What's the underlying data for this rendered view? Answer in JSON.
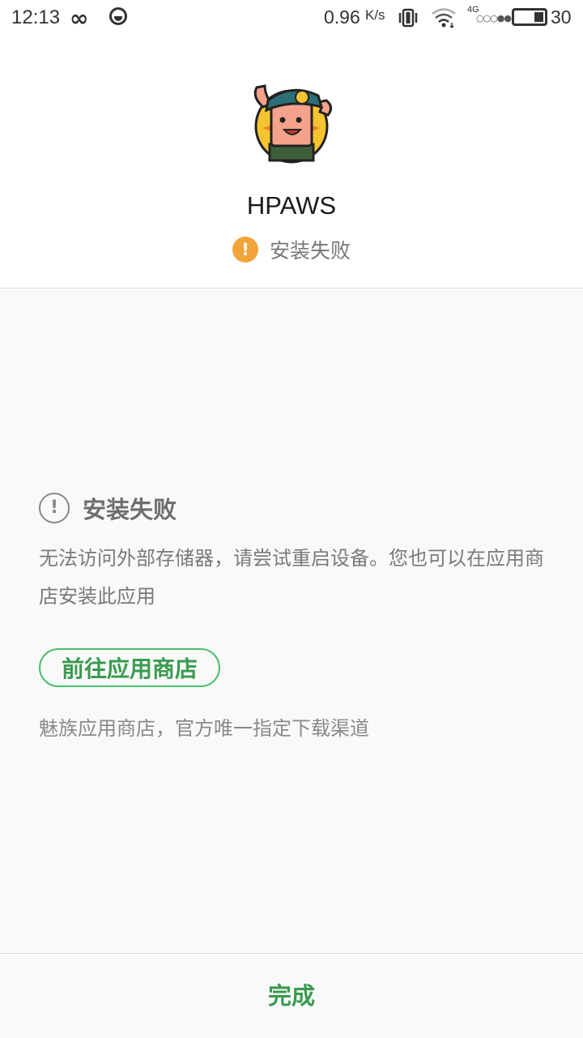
{
  "status_bar": {
    "time": "12:13",
    "speed": "0.96",
    "speed_unit": "K/s",
    "network_type": "4G",
    "battery_level": "30"
  },
  "app": {
    "name": "HPAWS",
    "install_status": "安装失败",
    "status_color": "#f0a43a"
  },
  "error": {
    "title": "安装失败",
    "message": "无法访问外部存储器，请尝试重启设备。您也可以在应用商店安装此应用"
  },
  "store": {
    "button_label": "前往应用商店",
    "note": "魅族应用商店，官方唯一指定下载渠道",
    "accent_color": "#4cbf6b"
  },
  "footer": {
    "done_label": "完成"
  }
}
